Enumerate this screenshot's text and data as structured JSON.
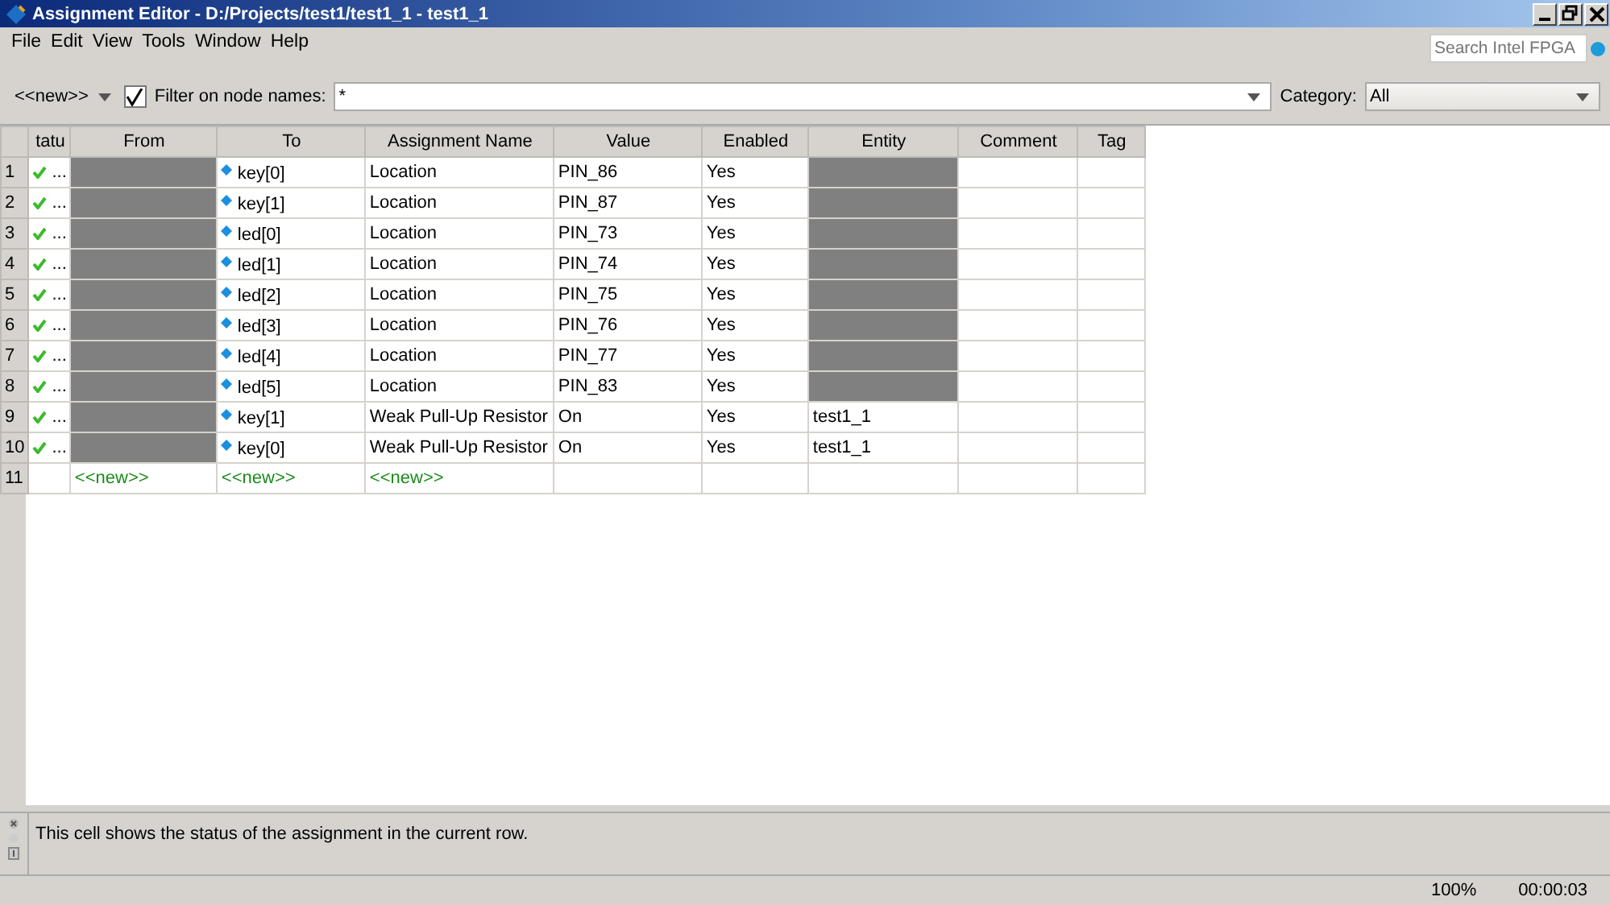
{
  "window": {
    "title": "Assignment Editor - D:/Projects/test1/test1_1 - test1_1"
  },
  "menu": [
    "File",
    "Edit",
    "View",
    "Tools",
    "Window",
    "Help"
  ],
  "search": {
    "placeholder": "Search Intel FPGA"
  },
  "toolbar": {
    "new_value": "<<new>>",
    "filter_checked": true,
    "filter_label": "Filter on node names:",
    "filter_value": "*",
    "category_label": "Category:",
    "category_value": "All"
  },
  "table": {
    "columns": [
      "tatu",
      "From",
      "To",
      "Assignment Name",
      "Value",
      "Enabled",
      "Entity",
      "Comment",
      "Tag"
    ],
    "rows": [
      {
        "kind": "assignment",
        "num": "1",
        "status_ok": true,
        "status_text": "...",
        "from_grey": true,
        "to": "key[0]",
        "assignment": "Location",
        "value": "PIN_86",
        "enabled": "Yes",
        "entity_grey": true
      },
      {
        "kind": "assignment",
        "num": "2",
        "status_ok": true,
        "status_text": "...",
        "from_grey": true,
        "to": "key[1]",
        "assignment": "Location",
        "value": "PIN_87",
        "enabled": "Yes",
        "entity_grey": true
      },
      {
        "kind": "assignment",
        "num": "3",
        "status_ok": true,
        "status_text": "...",
        "from_grey": true,
        "to": "led[0]",
        "assignment": "Location",
        "value": "PIN_73",
        "enabled": "Yes",
        "entity_grey": true
      },
      {
        "kind": "assignment",
        "num": "4",
        "status_ok": true,
        "status_text": "...",
        "from_grey": true,
        "to": "led[1]",
        "assignment": "Location",
        "value": "PIN_74",
        "enabled": "Yes",
        "entity_grey": true
      },
      {
        "kind": "assignment",
        "num": "5",
        "status_ok": true,
        "status_text": "...",
        "from_grey": true,
        "to": "led[2]",
        "assignment": "Location",
        "value": "PIN_75",
        "enabled": "Yes",
        "entity_grey": true
      },
      {
        "kind": "assignment",
        "num": "6",
        "status_ok": true,
        "status_text": "...",
        "from_grey": true,
        "to": "led[3]",
        "assignment": "Location",
        "value": "PIN_76",
        "enabled": "Yes",
        "entity_grey": true
      },
      {
        "kind": "assignment",
        "num": "7",
        "status_ok": true,
        "status_text": "...",
        "from_grey": true,
        "to": "led[4]",
        "assignment": "Location",
        "value": "PIN_77",
        "enabled": "Yes",
        "entity_grey": true
      },
      {
        "kind": "assignment",
        "num": "8",
        "status_ok": true,
        "status_text": "...",
        "from_grey": true,
        "to": "led[5]",
        "assignment": "Location",
        "value": "PIN_83",
        "enabled": "Yes",
        "entity_grey": true
      },
      {
        "kind": "assignment",
        "num": "9",
        "status_ok": true,
        "status_text": "...",
        "from_grey": true,
        "to": "key[1]",
        "assignment": "Weak Pull-Up Resistor",
        "value": "On",
        "enabled": "Yes",
        "entity_grey": false,
        "entity": "test1_1"
      },
      {
        "kind": "assignment",
        "num": "10",
        "status_ok": true,
        "status_text": "...",
        "from_grey": true,
        "to": "key[0]",
        "assignment": "Weak Pull-Up Resistor",
        "value": "On",
        "enabled": "Yes",
        "entity_grey": false,
        "entity": "test1_1"
      },
      {
        "kind": "new",
        "num": "11",
        "from": "<<new>>",
        "to": "<<new>>",
        "assignment": "<<new>>"
      }
    ]
  },
  "message": "This cell shows the status of the assignment in the current row.",
  "status_bar": {
    "zoom": "100%",
    "time": "00:00:03"
  }
}
